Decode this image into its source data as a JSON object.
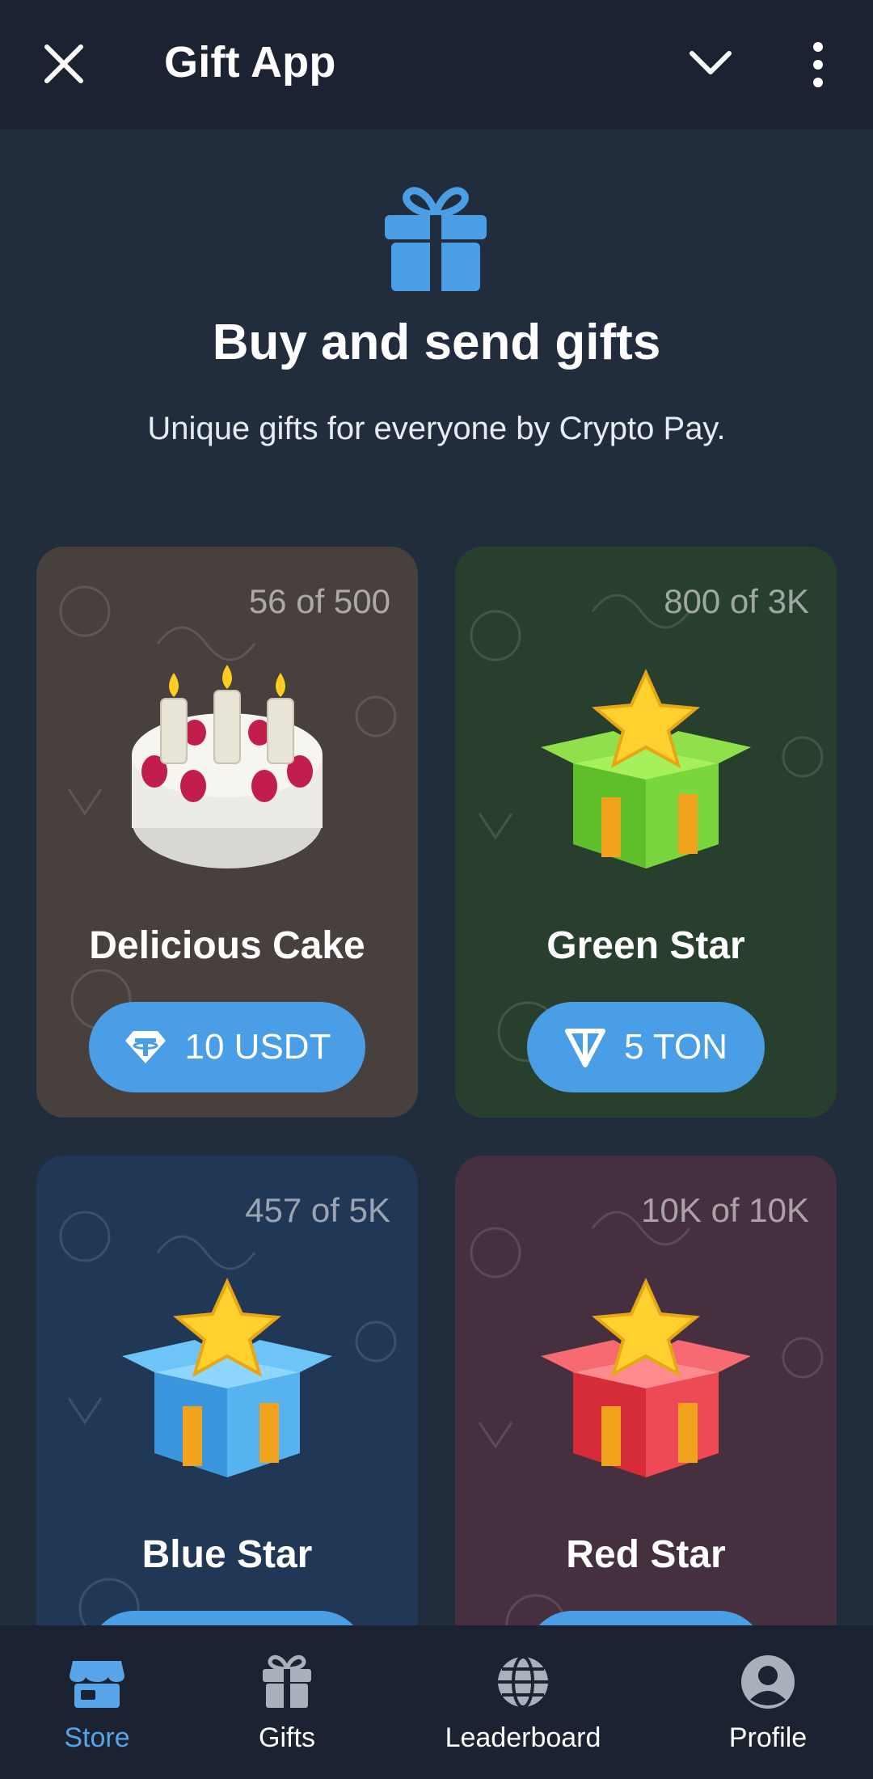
{
  "header": {
    "title": "Gift App",
    "close_icon": "close-icon",
    "menu_icon": "chevron-down-icon",
    "more_icon": "more-vertical-icon"
  },
  "hero": {
    "icon": "gift-icon",
    "title": "Buy and send gifts",
    "subtitle": "Unique gifts for everyone by Crypto Pay."
  },
  "gifts": [
    {
      "name": "Delicious Cake",
      "count": "56 of 500",
      "price": "10 USDT",
      "currency_icon": "usdt-icon",
      "bg": "#47403d"
    },
    {
      "name": "Green Star",
      "count": "800 of 3K",
      "price": "5 TON",
      "currency_icon": "ton-icon",
      "bg": "#283f2e"
    },
    {
      "name": "Blue Star",
      "count": "457 of 5K",
      "price": "",
      "currency_icon": "",
      "bg": "#213756"
    },
    {
      "name": "Red Star",
      "count": "10K of 10K",
      "price": "",
      "currency_icon": "",
      "bg": "#463040"
    }
  ],
  "nav": {
    "items": [
      {
        "label": "Store",
        "icon": "store-icon",
        "active": true
      },
      {
        "label": "Gifts",
        "icon": "gift-icon",
        "active": false
      },
      {
        "label": "Leaderboard",
        "icon": "globe-icon",
        "active": false
      },
      {
        "label": "Profile",
        "icon": "profile-icon",
        "active": false
      }
    ]
  },
  "colors": {
    "accent": "#4a9ee5",
    "background": "#212c3c",
    "header": "#1b2332"
  }
}
